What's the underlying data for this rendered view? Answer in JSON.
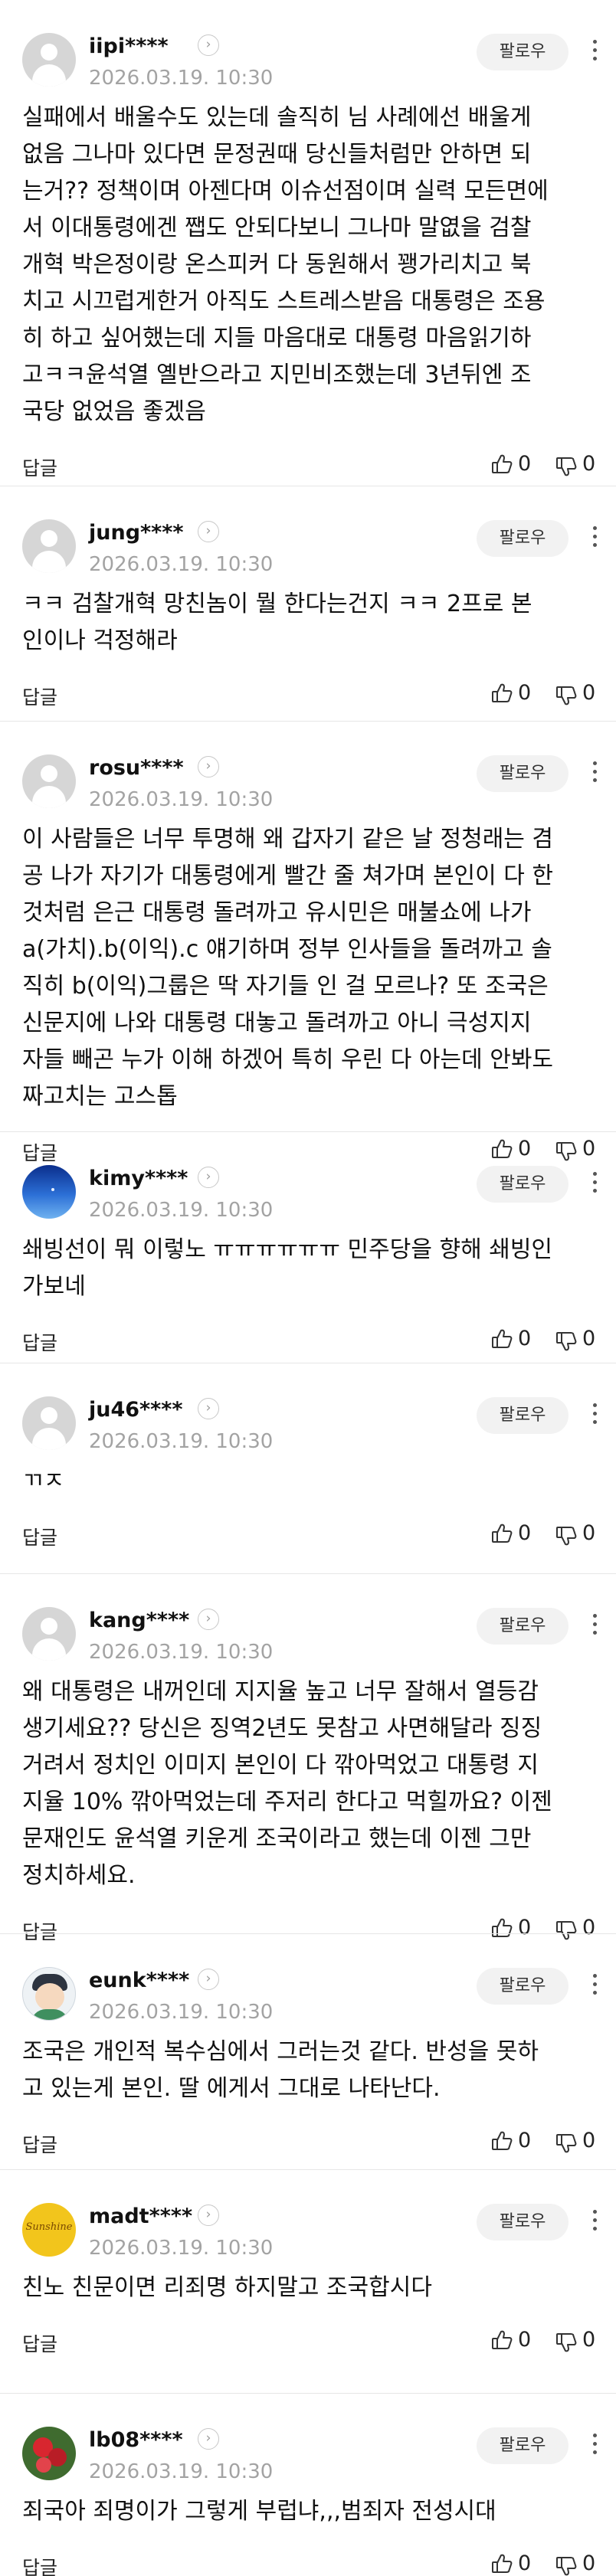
{
  "comments": [
    {
      "username": "iipi****",
      "date": "2026.03.19. 10:30",
      "avatar": "default-user-icon",
      "follow_label": "팔로우",
      "text_lines": [
        "실패에서 배울수도 있는데 솔직히 님 사례에선 배울게",
        "없음 그나마 있다면 문정권때 당신들처럼만 안하면 되",
        "는거?? 정책이며 아젠다며 이슈선점이며 실력 모든면에",
        "서 이대통령에겐 쨉도 안되다보니 그나마 말엾을 검찰",
        "개혁 박은정이랑 온스피커 다 동원해서 꽹가리치고 북",
        "치고 시끄럽게한거 아직도 스트레스받음 대통령은 조용",
        "히 하고 싶어했는데 지들 마음대로 대통령 마음읽기하",
        "고ㅋㅋ윤석열 옐반으라고 지민비조했는데 3년뒤엔 조",
        "국당 없었음 좋겠음"
      ],
      "reply_label": "답글",
      "likes": "0",
      "dislikes": "0"
    },
    {
      "username": "jung****",
      "date": "2026.03.19. 10:30",
      "avatar": "default-user-icon",
      "follow_label": "팔로우",
      "text_lines": [
        "ㅋㅋ 검찰개혁 망친놈이 뭘 한다는건지 ㅋㅋ 2프로 본",
        "인이나 걱정해라"
      ],
      "reply_label": "답글",
      "likes": "0",
      "dislikes": "0"
    },
    {
      "username": "rosu****",
      "date": "2026.03.19. 10:30",
      "avatar": "default-user-icon",
      "follow_label": "팔로우",
      "text_lines": [
        "이 사람들은 너무 투명해 왜 갑자기 같은 날 정청래는 겸",
        "공 나가 자기가 대통령에게 빨간 줄 쳐가며 본인이 다 한",
        "것처럼 은근 대통령 돌려까고 유시민은 매불쇼에 나가",
        "a(가치).b(이익).c 얘기하며 정부 인사들을 돌려까고 솔",
        "직히 b(이익)그룹은 딱 자기들 인 걸 모르나? 또 조국은",
        "신문지에 나와 대통령 대놓고 돌려까고 아니 극성지지",
        "자들 빼곤 누가 이해 하겠어 특히 우린 다 아는데 안봐도",
        "짜고치는 고스톱"
      ],
      "reply_label": "답글",
      "likes": "0",
      "dislikes": "0"
    },
    {
      "username": "kimy****",
      "date": "2026.03.19. 10:30",
      "avatar": "sky-photo-avatar",
      "follow_label": "팔로우",
      "text_lines": [
        "쇄빙선이 뭐 이렇노 ㅠㅠㅠㅠㅠㅠ 민주당을 향해 쇄빙인",
        "가보네"
      ],
      "reply_label": "답글",
      "likes": "0",
      "dislikes": "0"
    },
    {
      "username": "ju46****",
      "date": "2026.03.19. 10:30",
      "avatar": "default-user-icon",
      "follow_label": "팔로우",
      "text_lines": [
        "ㄲㅈ"
      ],
      "reply_label": "답글",
      "likes": "0",
      "dislikes": "0"
    },
    {
      "username": "kang****",
      "date": "2026.03.19. 10:30",
      "avatar": "default-user-icon",
      "follow_label": "팔로우",
      "text_lines": [
        "왜 대통령은 내꺼인데 지지율 높고 너무 잘해서 열등감",
        "생기세요?? 당신은 징역2년도 못참고 사면해달라 징징",
        "거려서 정치인 이미지 본인이 다 깎아먹었고 대통령 지",
        "지율 10% 깎아먹었는데 주저리 한다고 먹힐까요? 이젠",
        "문재인도 윤석열 키운게 조국이라고 했는데 이젠 그만",
        "정치하세요."
      ],
      "reply_label": "답글",
      "likes": "0",
      "dislikes": "0"
    },
    {
      "username": "eunk****",
      "date": "2026.03.19. 10:30",
      "avatar": "cartoon-avatar",
      "follow_label": "팔로우",
      "text_lines": [
        "조국은 개인적 복수심에서 그러는것 같다. 반성을 못하",
        "고 있는게 본인. 딸 에게서 그대로 나타난다."
      ],
      "reply_label": "답글",
      "likes": "0",
      "dislikes": "0"
    },
    {
      "username": "madt****",
      "date": "2026.03.19. 10:30",
      "avatar": "sunshine-logo-avatar",
      "avatar_text": "Sunshine",
      "follow_label": "팔로우",
      "text_lines": [
        "친노 친문이면 리죄명 하지말고 조국합시다"
      ],
      "reply_label": "답글",
      "likes": "0",
      "dislikes": "0"
    },
    {
      "username": "lb08****",
      "date": "2026.03.19. 10:30",
      "avatar": "flower-photo-avatar",
      "follow_label": "팔로우",
      "text_lines": [
        "죄국아 죄명이가 그렇게 부럽냐,,,범죄자 전성시대"
      ],
      "reply_label": "답글",
      "likes": "0",
      "dislikes": "0"
    }
  ],
  "colors": {
    "date": "#a3a3a3",
    "follow_bg": "#f2f2f2",
    "separator": "#e6e6e6",
    "text": "#111111"
  }
}
